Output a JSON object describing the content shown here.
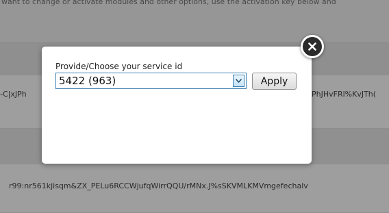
{
  "background": {
    "intro_text": "want to change or activate modules and other options, use the activation key below and",
    "key_fragment_left": "-C|xJPh",
    "key_fragment_right": "PhJHvFRl%KvJTh(",
    "activation_key_2": "r99:nr561kjisqm&ZX_PELu6RCCWjufqWirrQQU/rMNx.J%sSKVMLKMVmgefechalv"
  },
  "modal": {
    "label": "Provide/Choose your service id",
    "select": {
      "selected_value": "5422 (963)",
      "arrow_icon": "chevron-down-icon"
    },
    "apply_label": "Apply",
    "close_icon": "close-icon"
  },
  "colors": {
    "overlay": "#000000",
    "select_border": "#3c7fb1",
    "close_button": "#2b2b2b"
  }
}
